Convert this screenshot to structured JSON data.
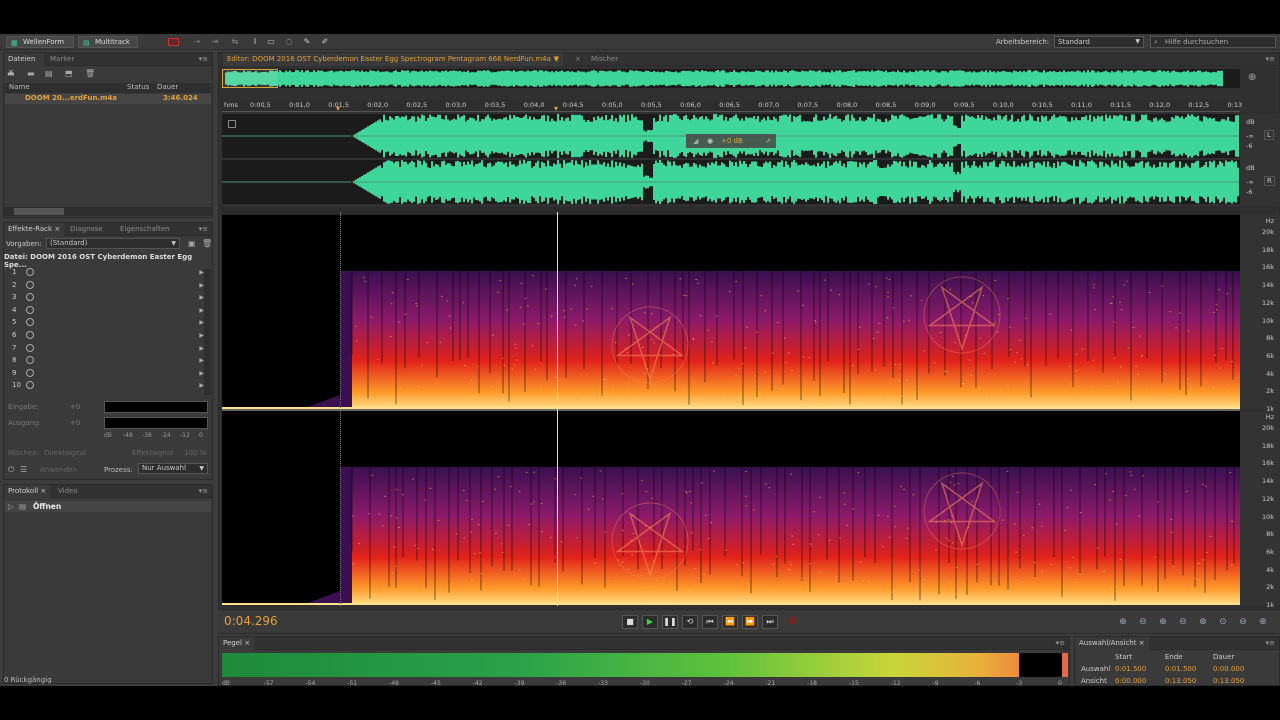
{
  "topbar": {
    "waveform_btn": "WellenForm",
    "multitrack_btn": "Multitrack",
    "workspace_label": "Arbeitsbereich:",
    "workspace_value": "Standard",
    "search_placeholder": "Hilfe durchsuchen"
  },
  "files_panel": {
    "tabs": [
      "Dateien",
      "Marker"
    ],
    "columns": [
      "Name",
      "Status",
      "Dauer"
    ],
    "file_name": "DOOM 20...erdFun.m4a",
    "file_duration": "3:46.024"
  },
  "effects_panel": {
    "tabs": [
      "Effekte-Rack",
      "Diagnose",
      "Eigenschaften"
    ],
    "preset_label": "Vorgaben:",
    "preset_value": "(Standard)",
    "file_label": "Datei: DOOM 2016 OST Cyberdemon Easter Egg Spe...",
    "slots": [
      "1",
      "2",
      "3",
      "4",
      "5",
      "6",
      "7",
      "8",
      "9",
      "10"
    ],
    "input_label": "Eingabe:",
    "output_label": "Ausgang:",
    "input_gain": "+0",
    "output_gain": "+0",
    "meter_scale": [
      "dB",
      "-48",
      "-36",
      "-24",
      "-12",
      "0"
    ],
    "mix_label": "Mischen:",
    "dry_label": "Direktsignal",
    "wet_label": "Effektsignal",
    "wet_value": "100 %",
    "apply_label": "Anwenden",
    "process_label": "Prozess:",
    "process_value": "Nur Auswahl"
  },
  "history_panel": {
    "tabs": [
      "Protokoll",
      "Video"
    ],
    "item": "Öffnen",
    "status": "0 Rückgängig"
  },
  "editor": {
    "tab": "Editor: DOOM 2016 OST Cyberdemon Easter Egg Spectrogram Pentagram 666 NerdFun.m4a",
    "mixer_tab": "Mischer",
    "ruler": [
      "hms",
      "0:00,5",
      "0:01,0",
      "0:01,5",
      "0:02,0",
      "0:02,5",
      "0:03,0",
      "0:03,5",
      "0:04,0",
      "0:04,5",
      "0:05,0",
      "0:05,5",
      "0:06,0",
      "0:06,5",
      "0:07,0",
      "0:07,5",
      "0:08,0",
      "0:08,5",
      "0:09,0",
      "0:09,5",
      "0:10,0",
      "0:10,5",
      "0:11,0",
      "0:11,5",
      "0:12,0",
      "0:12,5",
      "0:13"
    ],
    "hud_value": "+0 dB",
    "db_scale_top": [
      "dB",
      "-∞",
      "-6"
    ],
    "db_scale_bottom": [
      "dB",
      "-∞",
      "-6"
    ],
    "channel_left": "L",
    "channel_right": "R",
    "hz_labels": [
      "Hz",
      "20k",
      "18k",
      "16k",
      "14k",
      "12k",
      "10k",
      "8k",
      "6k",
      "4k",
      "2k",
      "1k"
    ],
    "time_display": "0:04.296"
  },
  "level_panel": {
    "tab": "Pegel",
    "scale": [
      "dB",
      "-57",
      "-54",
      "-51",
      "-48",
      "-45",
      "-42",
      "-39",
      "-36",
      "-33",
      "-30",
      "-27",
      "-24",
      "-21",
      "-18",
      "-15",
      "-12",
      "-9",
      "-6",
      "-3",
      "0"
    ]
  },
  "selection_panel": {
    "tab": "Auswahl/Ansicht",
    "headers": [
      "Start",
      "Ende",
      "Dauer"
    ],
    "row1_label": "Auswahl",
    "row1": [
      "0:01.500",
      "0:01.500",
      "0:00.000"
    ],
    "row2_label": "Ansicht",
    "row2": [
      "0:00.000",
      "0:13.050",
      "0:13.050"
    ]
  },
  "colors": {
    "waveform": "#3fd69b",
    "accent": "#e3a13a"
  }
}
